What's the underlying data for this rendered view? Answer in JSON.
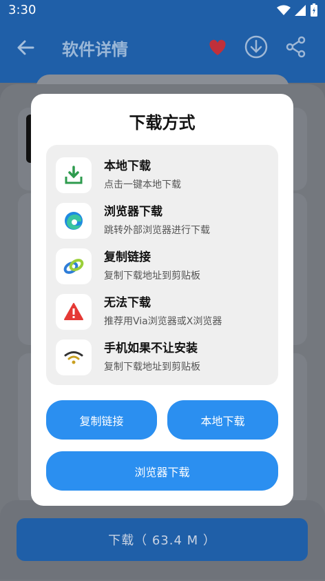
{
  "status": {
    "time": "3:30"
  },
  "header": {
    "title": "软件详情"
  },
  "dialog": {
    "title": "下载方式",
    "items": [
      {
        "name": "本地下载",
        "desc": "点击一键本地下载",
        "icon": "download-box-icon"
      },
      {
        "name": "浏览器下载",
        "desc": "跳转外部浏览器进行下载",
        "icon": "edge-browser-icon"
      },
      {
        "name": "复制链接",
        "desc": "复制下载地址到剪贴板",
        "icon": "link-icon"
      },
      {
        "name": "无法下载",
        "desc": "推荐用Via浏览器或X浏览器",
        "icon": "warning-icon"
      },
      {
        "name": "手机如果不让安装",
        "desc": "复制下载地址到剪贴板",
        "icon": "wifi-icon"
      }
    ],
    "buttons": {
      "copy": "复制链接",
      "local": "本地下载",
      "browser": "浏览器下载"
    }
  },
  "bottom": {
    "download_label": "下载（ 63.4 M ）"
  },
  "colors": {
    "primary": "#2b8ff0",
    "appbar": "#1f5fa8",
    "warning": "#e53935",
    "download_green": "#2e9b4e"
  }
}
